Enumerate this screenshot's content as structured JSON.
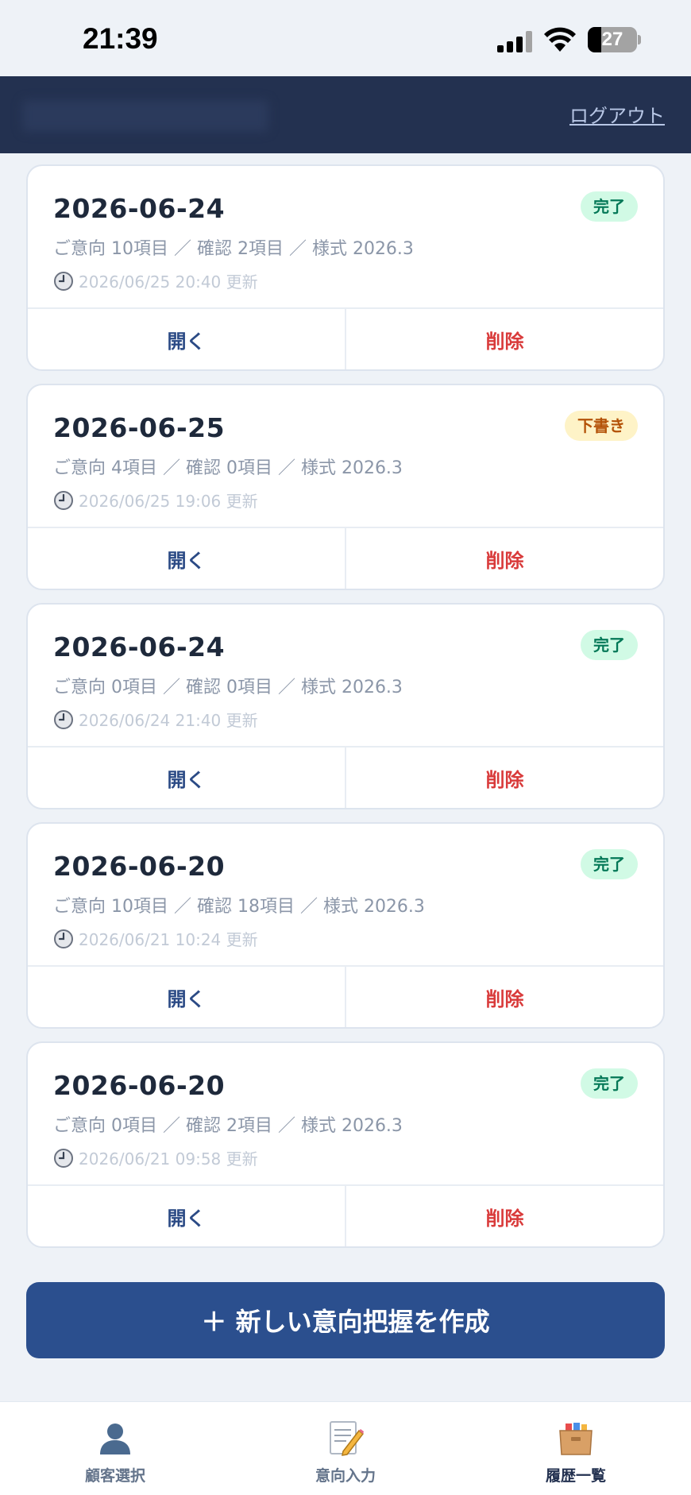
{
  "status_bar": {
    "time": "21:39",
    "battery": "27",
    "battery_level": 0.27
  },
  "header": {
    "logout": "ログアウト"
  },
  "cards": [
    {
      "date": "2026-06-24",
      "status": "完了",
      "status_type": "done",
      "summary": "ご意向 10項目 ／ 確認 2項目 ／ 様式 2026.3",
      "updated": "2026/06/25 20:40 更新"
    },
    {
      "date": "2026-06-25",
      "status": "下書き",
      "status_type": "draft",
      "summary": "ご意向 4項目 ／ 確認 0項目 ／ 様式 2026.3",
      "updated": "2026/06/25 19:06 更新"
    },
    {
      "date": "2026-06-24",
      "status": "完了",
      "status_type": "done",
      "summary": "ご意向 0項目 ／ 確認 0項目 ／ 様式 2026.3",
      "updated": "2026/06/24 21:40 更新"
    },
    {
      "date": "2026-06-20",
      "status": "完了",
      "status_type": "done",
      "summary": "ご意向 10項目 ／ 確認 18項目 ／ 様式 2026.3",
      "updated": "2026/06/21 10:24 更新"
    },
    {
      "date": "2026-06-20",
      "status": "完了",
      "status_type": "done",
      "summary": "ご意向 0項目 ／ 確認 2項目 ／ 様式 2026.3",
      "updated": "2026/06/21 09:58 更新"
    }
  ],
  "card_actions": {
    "open": "開く",
    "delete": "削除"
  },
  "create_button": "＋ 新しい意向把握を作成",
  "tabs": [
    {
      "label": "顧客選択",
      "icon": "person-icon"
    },
    {
      "label": "意向入力",
      "icon": "memo-icon"
    },
    {
      "label": "履歴一覧",
      "icon": "card-box-icon",
      "active": true
    }
  ],
  "colors": {
    "header": "#233150",
    "primary": "#2b4f8e",
    "delete": "#d93b3b",
    "badge_done_bg": "#d1fae5",
    "badge_draft_bg": "#fef3c7"
  }
}
